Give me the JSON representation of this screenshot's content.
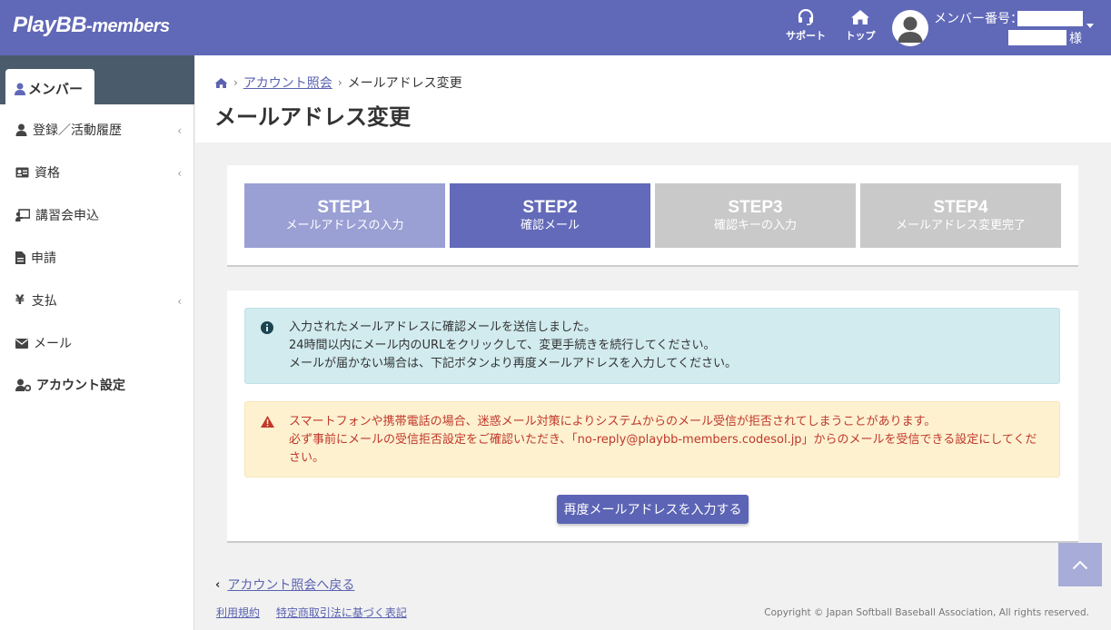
{
  "header": {
    "logo_main": "PlayBB",
    "logo_sub": "-members",
    "support_label": "サポート",
    "top_label": "トップ",
    "member_no_label": "メンバー番号：",
    "honorific": "様"
  },
  "sidebar": {
    "active_tab": "メンバー",
    "items": [
      {
        "label": "登録／活動履歴",
        "icon": "user-icon",
        "has_submenu": true
      },
      {
        "label": "資格",
        "icon": "id-card-icon",
        "has_submenu": true
      },
      {
        "label": "講習会申込",
        "icon": "chalkboard-icon",
        "has_submenu": false
      },
      {
        "label": "申請",
        "icon": "file-icon",
        "has_submenu": false
      },
      {
        "label": "支払",
        "icon": "yen-icon",
        "has_submenu": true
      },
      {
        "label": "メール",
        "icon": "envelope-icon",
        "has_submenu": false
      },
      {
        "label": "アカウント設定",
        "icon": "user-cog-icon",
        "has_submenu": false
      }
    ]
  },
  "breadcrumb": {
    "parent": "アカウント照会",
    "current": "メールアドレス変更"
  },
  "page_title": "メールアドレス変更",
  "steps": [
    {
      "num": "STEP1",
      "label": "メールアドレスの入力",
      "state": "done"
    },
    {
      "num": "STEP2",
      "label": "確認メール",
      "state": "active"
    },
    {
      "num": "STEP3",
      "label": "確認キーの入力",
      "state": "todo"
    },
    {
      "num": "STEP4",
      "label": "メールアドレス変更完了",
      "state": "todo"
    }
  ],
  "info_alert": {
    "line1": "入力されたメールアドレスに確認メールを送信しました。",
    "line2": "24時間以内にメール内のURLをクリックして、変更手続きを続行してください。",
    "line3": "メールが届かない場合は、下記ボタンより再度メールアドレスを入力してください。"
  },
  "warn_alert": {
    "line1": "スマートフォンや携帯電話の場合、迷惑メール対策によりシステムからのメール受信が拒否されてしまうことがあります。",
    "line2": "必ず事前にメールの受信拒否設定をご確認いただき、「no-reply@playbb-members.codesol.jp」からのメールを受信できる設定にしてください。"
  },
  "retry_button": "再度メールアドレスを入力する",
  "back_link": "アカウント照会へ戻る",
  "footer": {
    "terms": "利用規約",
    "tokusho": "特定商取引法に基づく表記",
    "copyright": "Copyright © Japan Softball Baseball Association, All rights reserved."
  },
  "colors": {
    "header": "#6068b8",
    "step_done": "#9aa0d4",
    "step_active": "#636ab9",
    "step_todo": "#c9c9c9",
    "info_bg": "#d1ebef",
    "warn_bg": "#fdf1d0",
    "warn_text": "#c0392b"
  }
}
